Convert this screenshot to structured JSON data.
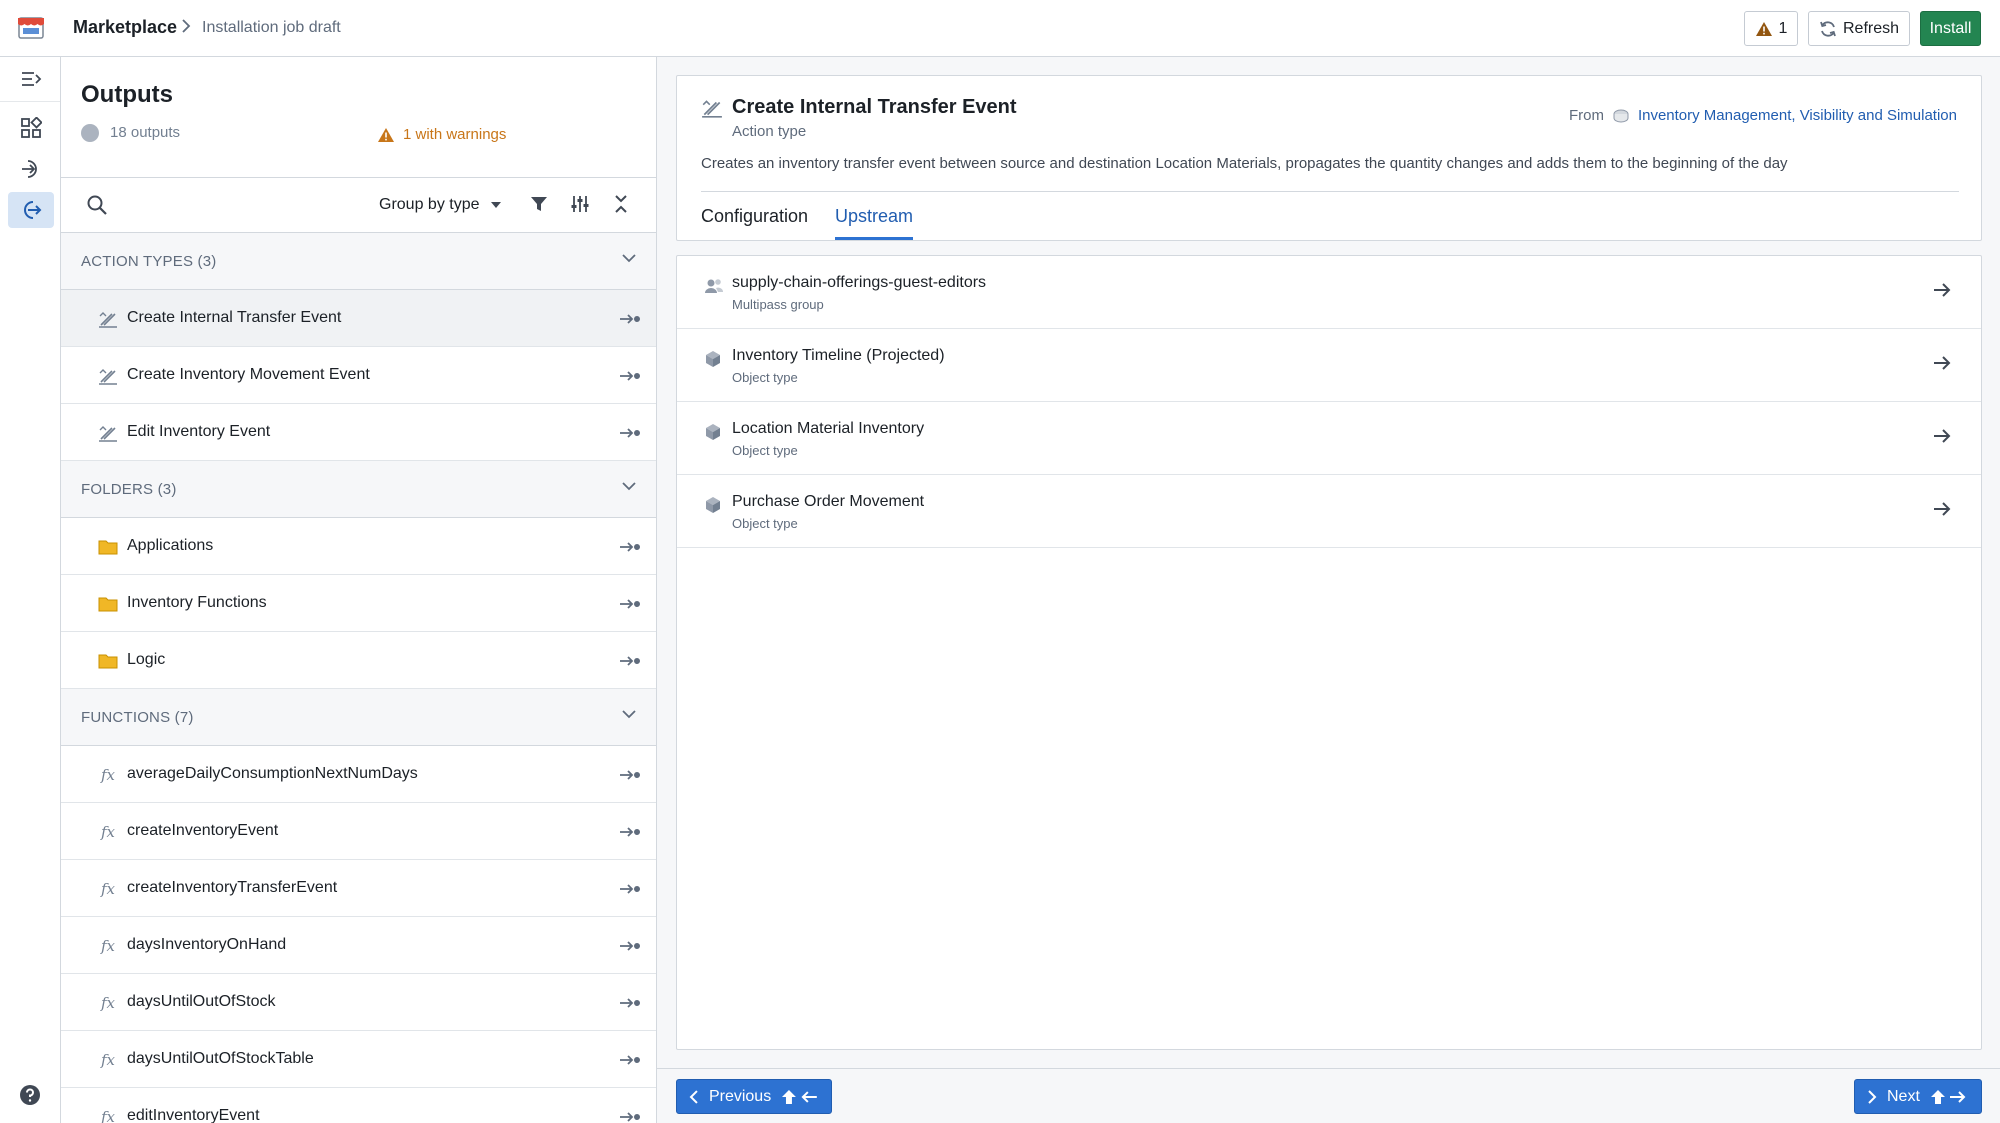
{
  "header": {
    "breadcrumb_root": "Marketplace",
    "breadcrumb_page": "Installation job draft",
    "warning_count": "1",
    "refresh_label": "Refresh",
    "install_label": "Install"
  },
  "outputs": {
    "title": "Outputs",
    "count_label": "18 outputs",
    "warnings_label": "1 with warnings",
    "group_by_label": "Group by type",
    "sections": [
      {
        "label": "ACTION TYPES (3)",
        "items": [
          "Create Internal Transfer Event",
          "Create Inventory Movement Event",
          "Edit Inventory Event"
        ]
      },
      {
        "label": "FOLDERS (3)",
        "items": [
          "Applications",
          "Inventory Functions",
          "Logic"
        ]
      },
      {
        "label": "FUNCTIONS (7)",
        "items": [
          "averageDailyConsumptionNextNumDays",
          "createInventoryEvent",
          "createInventoryTransferEvent",
          "daysInventoryOnHand",
          "daysUntilOutOfStock",
          "daysUntilOutOfStockTable",
          "editInventoryEvent"
        ]
      }
    ]
  },
  "detail": {
    "title": "Create Internal Transfer Event",
    "subtitle": "Action type",
    "from_label": "From",
    "from_link": "Inventory Management, Visibility and Simulation",
    "description": "Creates an inventory transfer event between source and destination Location Materials, propagates the quantity changes and adds them to the beginning of the day",
    "tabs": [
      "Configuration",
      "Upstream"
    ],
    "active_tab": "Upstream",
    "upstream": [
      {
        "name": "supply-chain-offerings-guest-editors",
        "type": "Multipass group",
        "icon": "group-icon"
      },
      {
        "name": "Inventory Timeline (Projected)",
        "type": "Object type",
        "icon": "cube-icon"
      },
      {
        "name": "Location Material Inventory",
        "type": "Object type",
        "icon": "cube-icon"
      },
      {
        "name": "Purchase Order Movement",
        "type": "Object type",
        "icon": "cube-icon"
      }
    ]
  },
  "footer": {
    "previous_label": "Previous",
    "next_label": "Next"
  },
  "colors": {
    "accent": "#2d72d2",
    "install": "#238551",
    "warning": "#c87619",
    "link": "#215db0"
  }
}
